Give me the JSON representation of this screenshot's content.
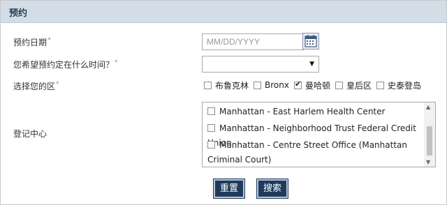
{
  "header": {
    "title": "预约"
  },
  "form": {
    "date": {
      "label": "预约日期",
      "required_mark": "*",
      "placeholder": "MM/DD/YYYY",
      "icon": "calendar-icon"
    },
    "time": {
      "label": "您希望预约定在什么时间？",
      "required_mark": "*",
      "value": ""
    },
    "district": {
      "label": "选择您的区",
      "required_mark": "*",
      "options": [
        {
          "label": "布鲁克林",
          "checked": false
        },
        {
          "label": "Bronx",
          "checked": false
        },
        {
          "label": "曼哈顿",
          "checked": true
        },
        {
          "label": "皇后区",
          "checked": false
        },
        {
          "label": "史泰登岛",
          "checked": false
        }
      ]
    },
    "center": {
      "label": "登记中心",
      "options": [
        {
          "label": "Manhattan - East Harlem Health Center",
          "checked": false
        },
        {
          "label": "Manhattan - Neighborhood Trust Federal Credit Union",
          "checked": false
        },
        {
          "label": "Manhattan - Centre Street Office (Manhattan Criminal Court)",
          "checked": false
        }
      ]
    }
  },
  "buttons": {
    "reset": "重置",
    "search": "搜索"
  },
  "colors": {
    "header_bg": "#d3dde8",
    "button_bg": "#1f3b5c"
  }
}
